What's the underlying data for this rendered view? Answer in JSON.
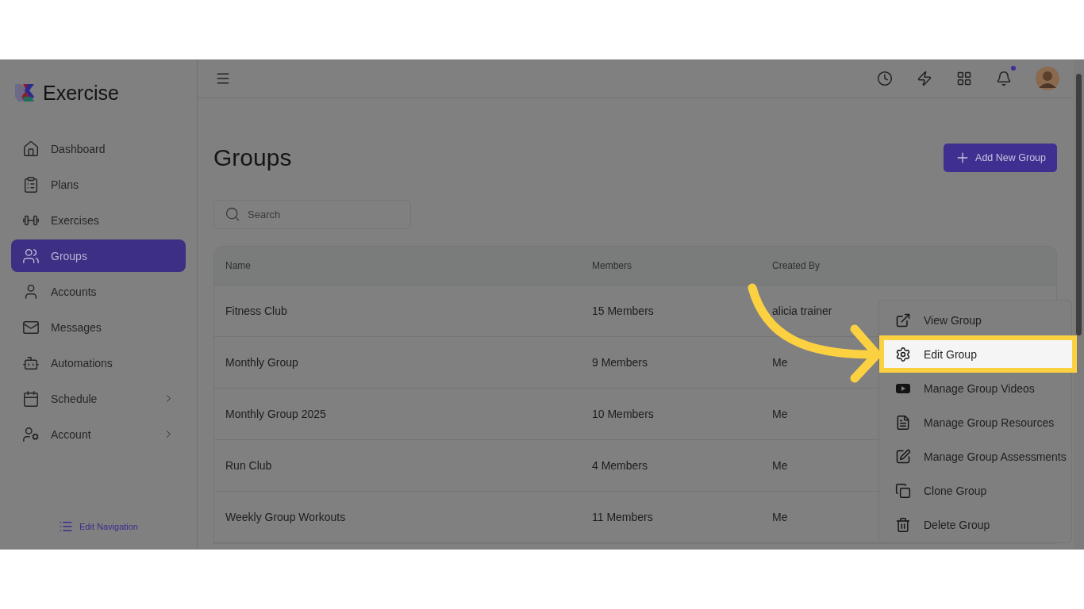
{
  "app": {
    "name": "Exercise"
  },
  "sidebar": {
    "items": [
      {
        "label": "Dashboard",
        "selected": false,
        "has_submenu": false
      },
      {
        "label": "Plans",
        "selected": false,
        "has_submenu": false
      },
      {
        "label": "Exercises",
        "selected": false,
        "has_submenu": false
      },
      {
        "label": "Groups",
        "selected": true,
        "has_submenu": false
      },
      {
        "label": "Accounts",
        "selected": false,
        "has_submenu": false
      },
      {
        "label": "Messages",
        "selected": false,
        "has_submenu": false
      },
      {
        "label": "Automations",
        "selected": false,
        "has_submenu": false
      },
      {
        "label": "Schedule",
        "selected": false,
        "has_submenu": true
      },
      {
        "label": "Account",
        "selected": false,
        "has_submenu": true
      }
    ],
    "footer_link": "Edit Navigation"
  },
  "topbar": {
    "has_notification": true
  },
  "page": {
    "title": "Groups",
    "add_button": "Add New Group",
    "search": {
      "placeholder": "Search"
    }
  },
  "table": {
    "columns": [
      "Name",
      "Members",
      "Created By"
    ],
    "rows": [
      [
        "Fitness Club",
        "15 Members",
        "alicia trainer"
      ],
      [
        "Monthly Group",
        "9 Members",
        "Me"
      ],
      [
        "Monthly Group 2025",
        "10 Members",
        "Me"
      ],
      [
        "Run Club",
        "4 Members",
        "Me"
      ],
      [
        "Weekly Group Workouts",
        "11 Members",
        "Me"
      ]
    ]
  },
  "context_menu": {
    "items": [
      {
        "label": "View Group",
        "selected": false
      },
      {
        "label": "Edit Group",
        "selected": true
      },
      {
        "label": "Manage Group Videos",
        "selected": false
      },
      {
        "label": "Manage Group Resources",
        "selected": false
      },
      {
        "label": "Manage Group Assessments",
        "selected": false
      },
      {
        "label": "Clone Group",
        "selected": false
      },
      {
        "label": "Delete Group",
        "selected": false
      }
    ]
  }
}
